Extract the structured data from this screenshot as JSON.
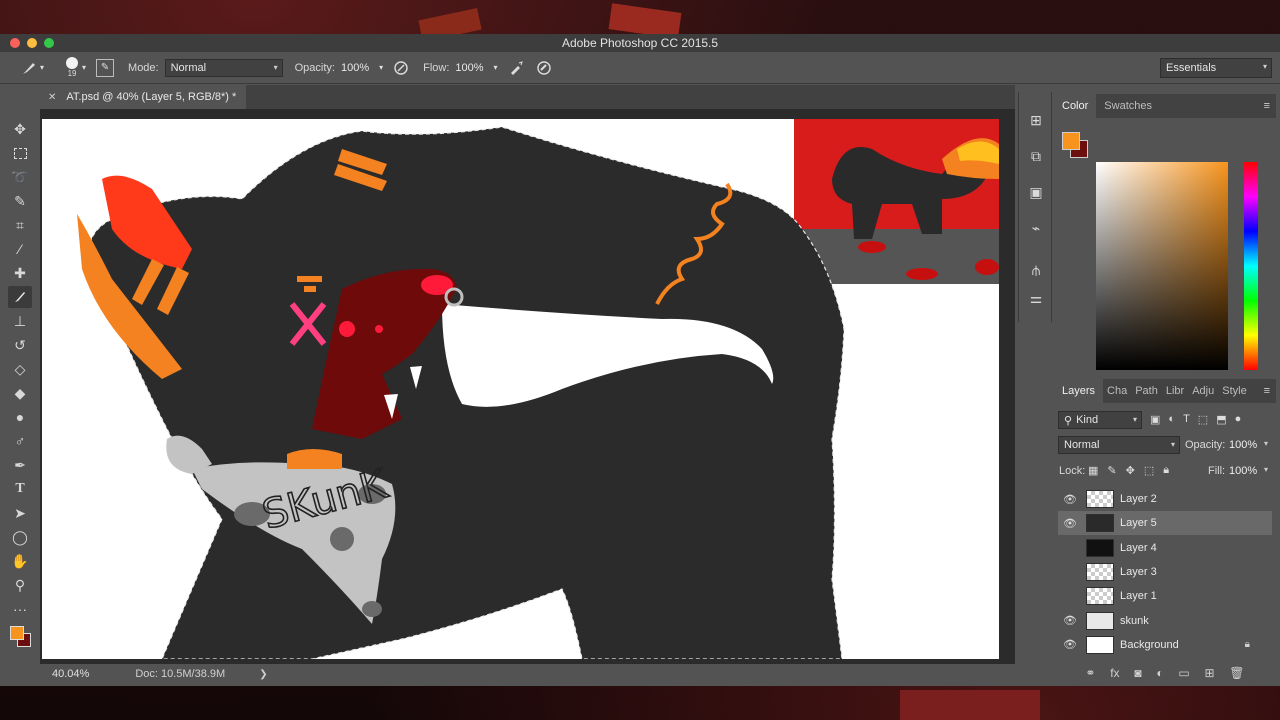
{
  "app": {
    "title": "Adobe Photoshop CC 2015.5"
  },
  "options_bar": {
    "brush_size": "19",
    "mode_label": "Mode:",
    "mode_value": "Normal",
    "opacity_label": "Opacity:",
    "opacity_value": "100%",
    "flow_label": "Flow:",
    "flow_value": "100%",
    "workspace": "Essentials"
  },
  "document": {
    "tab_title": "AT.psd @ 40% (Layer 5, RGB/8*) *",
    "zoom": "40.04%",
    "doc_size": "Doc: 10.5M/38.9M",
    "canvas_text": "SKunK"
  },
  "colors": {
    "foreground": "#f7941d",
    "background": "#6b0f0f",
    "fur": "#2b2b2b",
    "accent_orange": "#f58220",
    "mouth_red": "#6e0a0a",
    "pink": "#ff3f7f"
  },
  "color_panel": {
    "tabs": [
      "Color",
      "Swatches"
    ]
  },
  "layers_panel": {
    "tabs": [
      "Layers",
      "Cha",
      "Path",
      "Libr",
      "Adju",
      "Style"
    ],
    "filter_kind": "Kind",
    "blend_mode": "Normal",
    "opacity_label": "Opacity:",
    "opacity_value": "100%",
    "lock_label": "Lock:",
    "fill_label": "Fill:",
    "fill_value": "100%",
    "layers": [
      {
        "name": "Layer 2",
        "visible": true,
        "selected": false
      },
      {
        "name": "Layer 5",
        "visible": true,
        "selected": true
      },
      {
        "name": "Layer 4",
        "visible": false,
        "selected": false
      },
      {
        "name": "Layer 3",
        "visible": false,
        "selected": false
      },
      {
        "name": "Layer 1",
        "visible": false,
        "selected": false
      },
      {
        "name": "skunk",
        "visible": true,
        "selected": false
      },
      {
        "name": "Background",
        "visible": true,
        "selected": false,
        "locked": true
      }
    ]
  },
  "icons": {
    "tools": [
      "move-icon",
      "marquee-icon",
      "lasso-icon",
      "quick-select-icon",
      "crop-icon",
      "eyedropper-icon",
      "healing-icon",
      "brush-icon",
      "stamp-icon",
      "history-brush-icon",
      "eraser-icon",
      "bucket-icon",
      "blur-icon",
      "dodge-icon",
      "pen-icon",
      "type-icon",
      "path-select-icon",
      "shape-icon",
      "hand-icon",
      "zoom-icon",
      "more-icon"
    ]
  }
}
